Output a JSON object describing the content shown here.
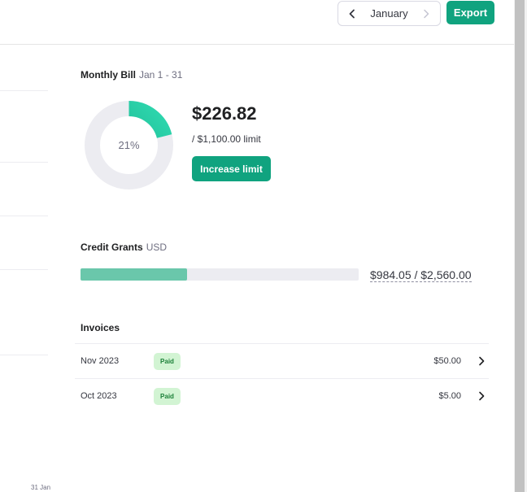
{
  "header": {
    "month": "January",
    "export_label": "Export"
  },
  "chart_axis": {
    "last_tick": "31 Jan"
  },
  "monthly_bill": {
    "title": "Monthly Bill",
    "range": "Jan 1 - 31",
    "percent_label": "21%",
    "percent_used": 0.21,
    "amount": "$226.82",
    "limit": "/ $1,100.00 limit",
    "increase_label": "Increase limit"
  },
  "credit_grants": {
    "title": "Credit Grants",
    "currency": "USD",
    "used_fraction": 0.384,
    "text": "$984.05 / $2,560.00"
  },
  "invoices": {
    "title": "Invoices",
    "rows": [
      {
        "date": "Nov 2023",
        "status": "Paid",
        "amount": "$50.00"
      },
      {
        "date": "Oct 2023",
        "status": "Paid",
        "amount": "$5.00"
      }
    ]
  },
  "colors": {
    "accent": "#10a37f",
    "donut_fill_start": "#10a37f",
    "donut_fill_end": "#2fd9b0",
    "donut_track": "#ececf1",
    "credit_fill": "#6ac7ab"
  }
}
